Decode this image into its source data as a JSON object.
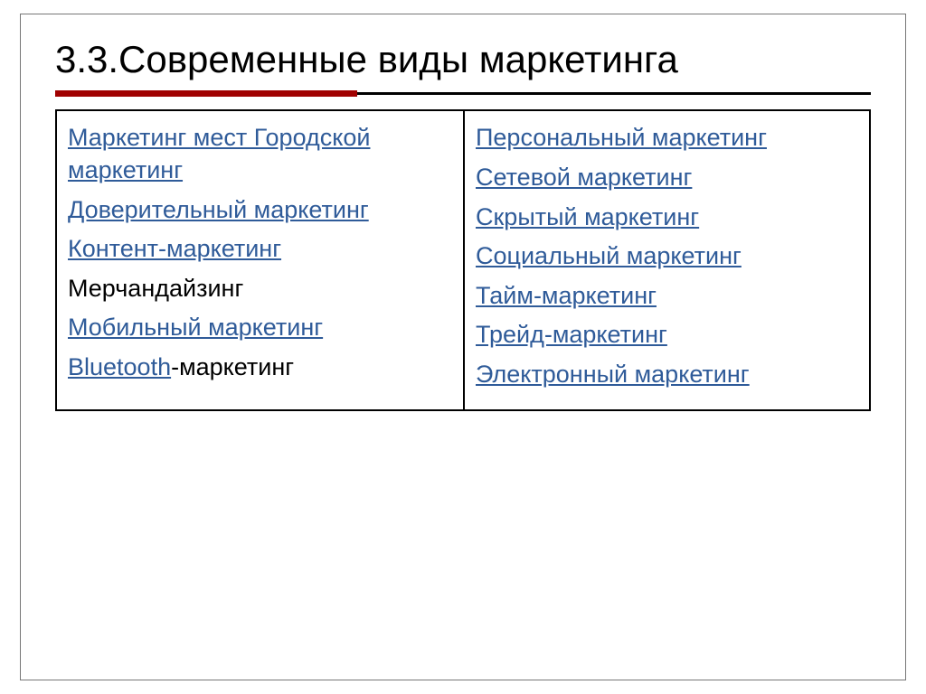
{
  "title": "3.3.Современные виды маркетинга",
  "left": {
    "i0": "Маркетинг мест Городской маркетинг",
    "i1": "Доверительный маркетинг",
    "i2": "Контент-маркетинг",
    "i3": "Мерчандайзинг",
    "i4": "Мобильный маркетинг",
    "i5a": "Bluetooth",
    "i5b": "-маркетинг"
  },
  "right": {
    "i0": "Персональный маркетинг",
    "i1": "Сетевой маркетинг",
    "i2": "Скрытый маркетинг",
    "i3": "Социальный маркетинг",
    "i4": "Тайм-маркетинг",
    "i5": "Трейд-маркетинг",
    "i6": "Электронный маркетинг"
  }
}
